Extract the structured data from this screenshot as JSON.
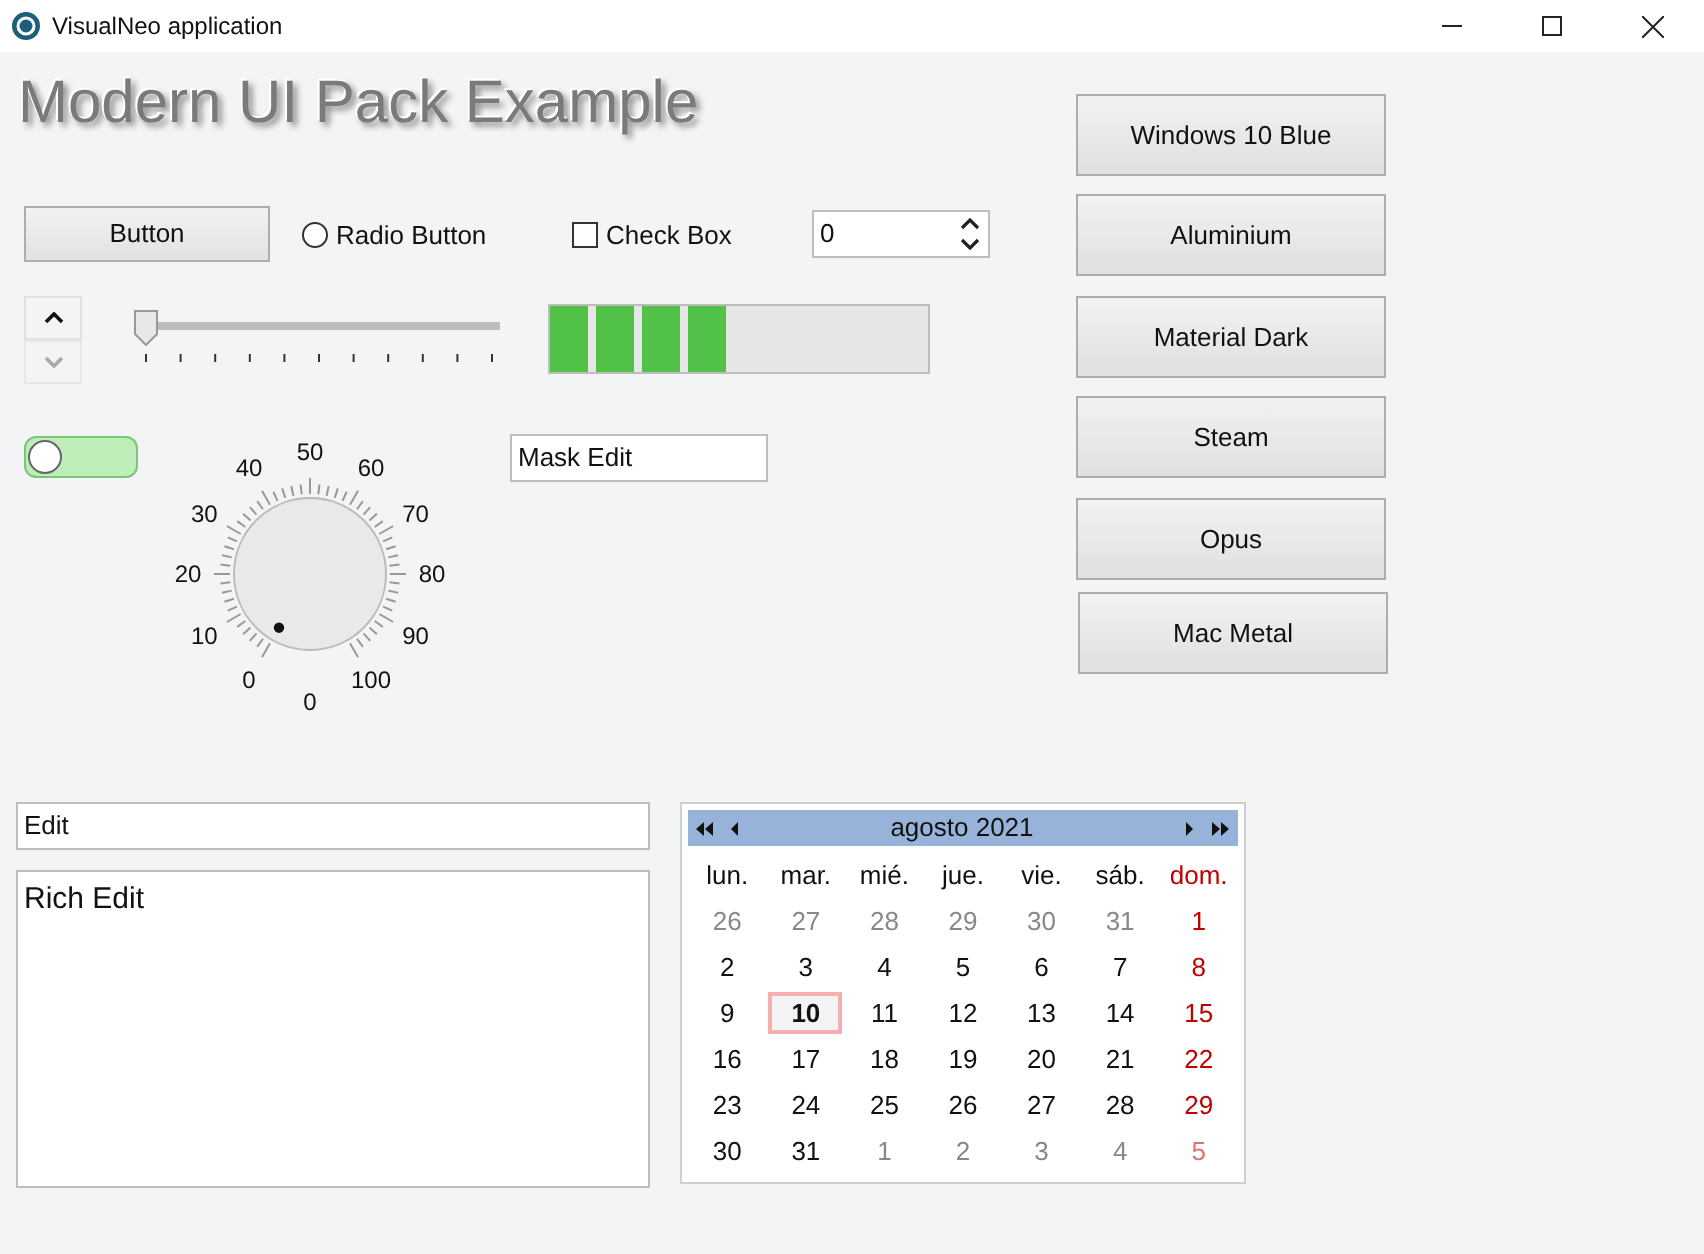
{
  "window": {
    "title": "VisualNeo application"
  },
  "heading": "Modern UI Pack Example",
  "button": {
    "label": "Button"
  },
  "radio": {
    "label": "Radio Button",
    "selected": false
  },
  "checkbox": {
    "label": "Check Box",
    "checked": false
  },
  "spin": {
    "value": "0"
  },
  "updown": {
    "down_disabled": true
  },
  "slider": {
    "level": 0
  },
  "mask_edit": {
    "value": "Mask Edit"
  },
  "toggle": {
    "on": false
  },
  "knob": {
    "labels": [
      "0",
      "10",
      "20",
      "30",
      "40",
      "50",
      "60",
      "70",
      "80",
      "90",
      "100"
    ],
    "value": "0"
  },
  "theme_buttons": [
    "Windows 10 Blue",
    "Aluminium",
    "Material Dark",
    "Steam",
    "Opus",
    "Mac Metal"
  ],
  "edit": {
    "value": "Edit"
  },
  "rich_edit": {
    "value": "Rich Edit"
  },
  "calendar": {
    "title": "agosto 2021",
    "weekdays": [
      "lun.",
      "mar.",
      "mié.",
      "jue.",
      "vie.",
      "sáb.",
      "dom."
    ],
    "weeks": [
      [
        {
          "text": "26",
          "kind": "other",
          "selected": false
        },
        {
          "text": "27",
          "kind": "other",
          "selected": false
        },
        {
          "text": "28",
          "kind": "other",
          "selected": false
        },
        {
          "text": "29",
          "kind": "other",
          "selected": false
        },
        {
          "text": "30",
          "kind": "other",
          "selected": false
        },
        {
          "text": "31",
          "kind": "other",
          "selected": false
        },
        {
          "text": "1",
          "kind": "current",
          "selected": false
        }
      ],
      [
        {
          "text": "2",
          "kind": "current",
          "selected": false
        },
        {
          "text": "3",
          "kind": "current",
          "selected": false
        },
        {
          "text": "4",
          "kind": "current",
          "selected": false
        },
        {
          "text": "5",
          "kind": "current",
          "selected": false
        },
        {
          "text": "6",
          "kind": "current",
          "selected": false
        },
        {
          "text": "7",
          "kind": "current",
          "selected": false
        },
        {
          "text": "8",
          "kind": "current",
          "selected": false
        }
      ],
      [
        {
          "text": "9",
          "kind": "current",
          "selected": false
        },
        {
          "text": "10",
          "kind": "current",
          "selected": true
        },
        {
          "text": "11",
          "kind": "current",
          "selected": false
        },
        {
          "text": "12",
          "kind": "current",
          "selected": false
        },
        {
          "text": "13",
          "kind": "current",
          "selected": false
        },
        {
          "text": "14",
          "kind": "current",
          "selected": false
        },
        {
          "text": "15",
          "kind": "current",
          "selected": false
        }
      ],
      [
        {
          "text": "16",
          "kind": "current",
          "selected": false
        },
        {
          "text": "17",
          "kind": "current",
          "selected": false
        },
        {
          "text": "18",
          "kind": "current",
          "selected": false
        },
        {
          "text": "19",
          "kind": "current",
          "selected": false
        },
        {
          "text": "20",
          "kind": "current",
          "selected": false
        },
        {
          "text": "21",
          "kind": "current",
          "selected": false
        },
        {
          "text": "22",
          "kind": "current",
          "selected": false
        }
      ],
      [
        {
          "text": "23",
          "kind": "current",
          "selected": false
        },
        {
          "text": "24",
          "kind": "current",
          "selected": false
        },
        {
          "text": "25",
          "kind": "current",
          "selected": false
        },
        {
          "text": "26",
          "kind": "current",
          "selected": false
        },
        {
          "text": "27",
          "kind": "current",
          "selected": false
        },
        {
          "text": "28",
          "kind": "current",
          "selected": false
        },
        {
          "text": "29",
          "kind": "current",
          "selected": false
        }
      ],
      [
        {
          "text": "30",
          "kind": "current",
          "selected": false
        },
        {
          "text": "31",
          "kind": "current",
          "selected": false
        },
        {
          "text": "1",
          "kind": "other",
          "selected": false
        },
        {
          "text": "2",
          "kind": "other",
          "selected": false
        },
        {
          "text": "3",
          "kind": "other",
          "selected": false
        },
        {
          "text": "4",
          "kind": "other",
          "selected": false
        },
        {
          "text": "5",
          "kind": "other",
          "selected": false
        }
      ]
    ]
  }
}
